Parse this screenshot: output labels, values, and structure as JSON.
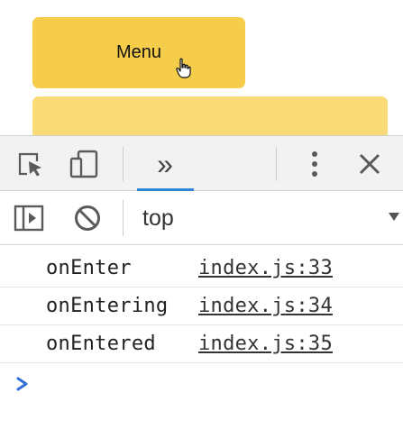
{
  "page": {
    "menu_button_label": "Menu"
  },
  "devtools": {
    "toolbar_icons": [
      "inspect-element-icon",
      "device-toolbar-icon",
      "more-tabs-icon",
      "kebab-menu-icon",
      "close-icon"
    ],
    "more_tabs_label": "»"
  },
  "console": {
    "context": "top",
    "filter_icons": [
      "sidebar-toggle-icon",
      "clear-console-icon"
    ],
    "logs": [
      {
        "message": "onEnter",
        "source": "index.js:33"
      },
      {
        "message": "onEntering",
        "source": "index.js:34"
      },
      {
        "message": "onEntered",
        "source": "index.js:35"
      }
    ],
    "prompt_symbol": "›"
  },
  "colors": {
    "menu_button": "#f6cd4b",
    "menu_panel": "#f9dc78",
    "active_tab_underline": "#2f86d6",
    "prompt": "#2f6fd6"
  }
}
